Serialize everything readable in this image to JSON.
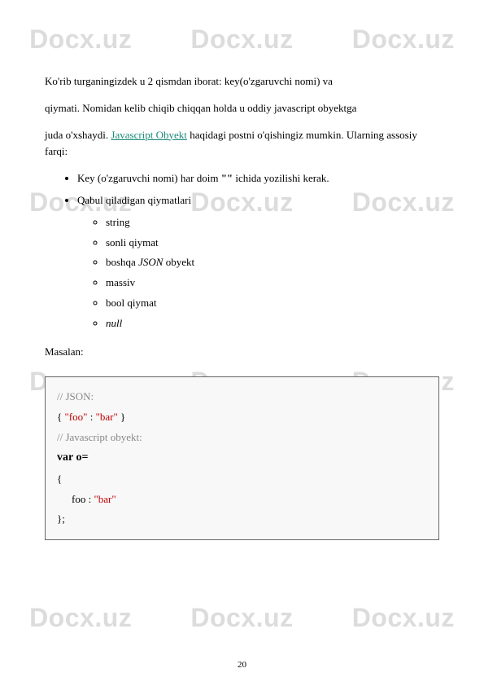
{
  "watermark": "Docx.uz",
  "para1": "Ko'rib turganingizdek u 2 qismdan iborat: key(o'zgaruvchi nomi) va",
  "para2": "qiymati. Nomidan kelib chiqib chiqqan holda u oddiy javascript obyektga",
  "para3_pre": "juda o'xshaydi. ",
  "link_text": "Javascript Obyekt",
  "para3_post": " haqidagi postni o'qishingiz mumkin. Ularning assosiy farqi:",
  "bullets": {
    "b1_pre": "Key (o'zgaruvchi nomi) har doim ",
    "b1_bold": "\"\"",
    "b1_post": " ichida yozilishi kerak.",
    "b2": "Qabul qiladigan qiymatlari",
    "sub": {
      "s1": "string",
      "s2": "sonli qiymat",
      "s3_pre": "boshqa ",
      "s3_i": "JSON",
      "s3_post": " obyekt",
      "s4": "massiv",
      "s5": "bool qiymat",
      "s6": "null"
    }
  },
  "masalan": "Masalan:",
  "code": {
    "l1": "// JSON:",
    "l2_a": "{ ",
    "l2_b": "\"foo\"",
    "l2_c": " : ",
    "l2_d": "\"bar\"",
    "l2_e": "   }",
    "l3": "// Javascript obyekt:",
    "l4": "var o=",
    "l5": "{",
    "l6_a": "foo : ",
    "l6_b": "\"bar\"",
    "l7": "};"
  },
  "page_number": "20"
}
